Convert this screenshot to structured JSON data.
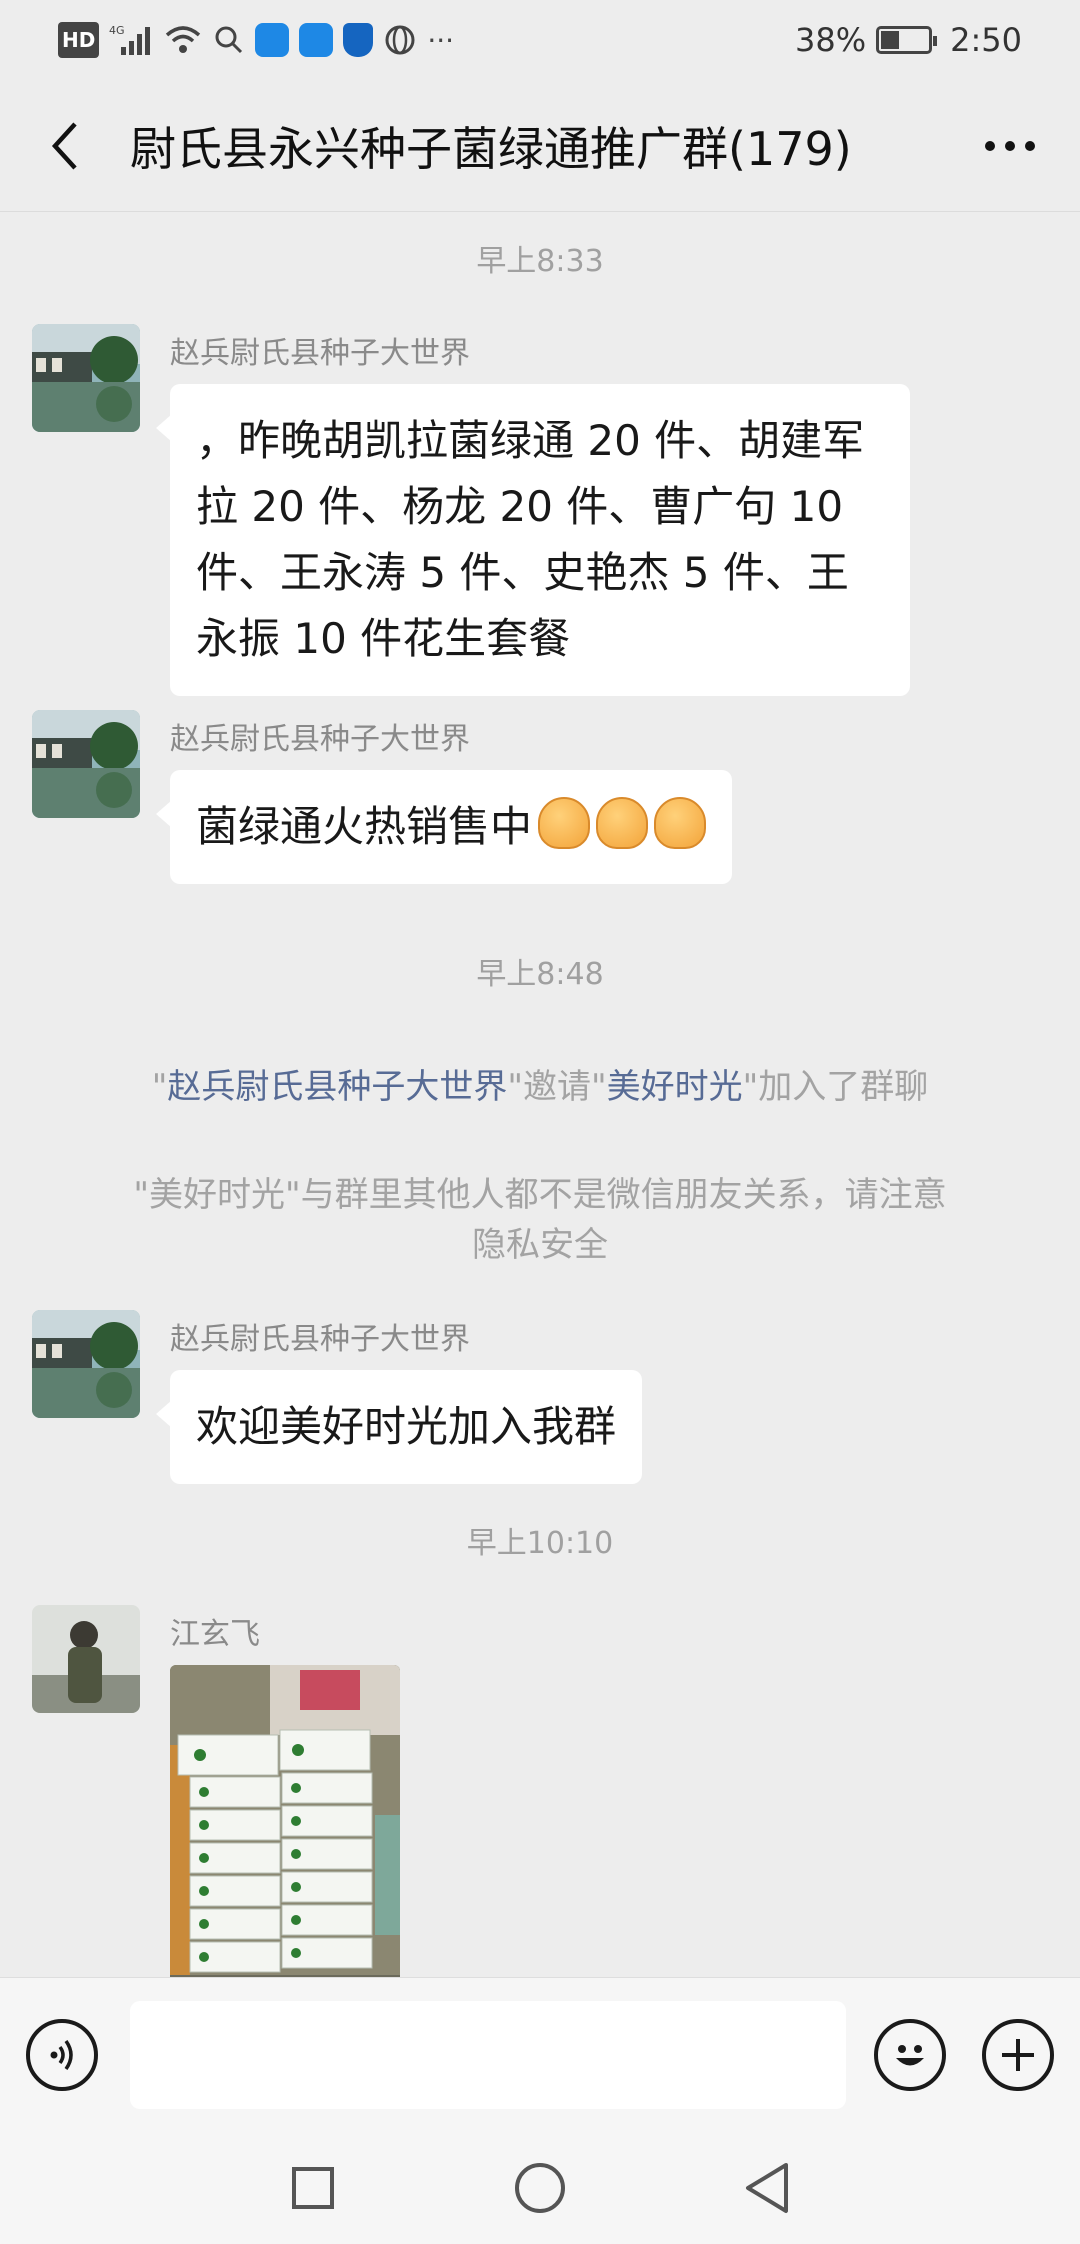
{
  "status_bar": {
    "hd": "HD",
    "network": "4G",
    "more": "···",
    "battery_percent": "38%",
    "battery_level": 0.38,
    "time": "2:50"
  },
  "header": {
    "title": "尉氏县永兴种子菌绿通推广群(179)"
  },
  "messages": [
    {
      "type": "time",
      "text": "早上8:33"
    },
    {
      "type": "text",
      "sender": "赵兵尉氏县种子大世界",
      "lines": [
        "，昨晚胡凯拉菌绿通 20 件、胡建军",
        "拉 20 件、杨龙 20 件、曹广句 10",
        "件、王永涛 5 件、史艳杰 5 件、王",
        "永振 10 件花生套餐"
      ]
    },
    {
      "type": "text",
      "sender": "赵兵尉氏县种子大世界",
      "text": "菌绿通火热销售中",
      "emoji": "fist-bump x3"
    },
    {
      "type": "time",
      "text": "早上8:48"
    },
    {
      "type": "system",
      "q1": "\"",
      "inviter": "赵兵尉氏县种子大世界",
      "q2": "\"邀请\"",
      "invitee": "美好时光",
      "q3": "\"加入了群聊"
    },
    {
      "type": "system",
      "line1": "\"美好时光\"与群里其他人都不是微信朋友关系，请注意",
      "line2": "隐私安全"
    },
    {
      "type": "text",
      "sender": "赵兵尉氏县种子大世界",
      "text": "欢迎美好时光加入我群"
    },
    {
      "type": "time",
      "text": "早上10:10"
    },
    {
      "type": "image",
      "sender": "江玄飞"
    }
  ],
  "input_bar": {
    "voice_icon": "voice-icon",
    "emoji_icon": "emoji-icon",
    "plus_icon": "plus-icon",
    "value": ""
  },
  "colors": {
    "background": "#ededed",
    "link": "#576b95",
    "bubble": "#ffffff"
  }
}
